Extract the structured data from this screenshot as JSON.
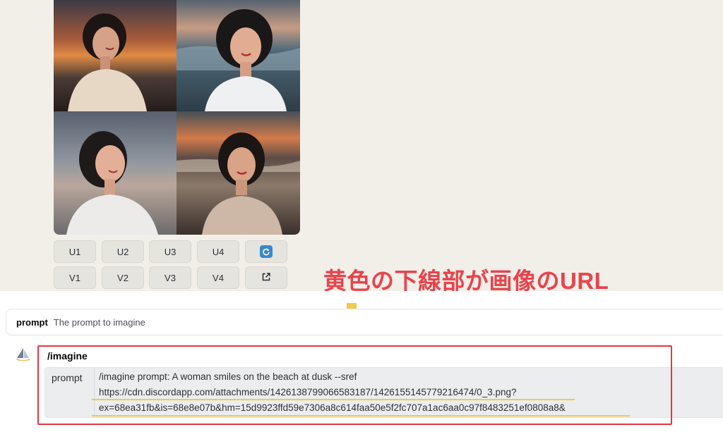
{
  "buttons": {
    "upscale": [
      "U1",
      "U2",
      "U3",
      "U4"
    ],
    "variation": [
      "V1",
      "V2",
      "V3",
      "V4"
    ],
    "reroll_icon": "refresh-icon",
    "share_icon": "external-link-icon"
  },
  "annotation": {
    "text": "黄色の下線部が画像のURL",
    "color": "#e8434b",
    "arrow_color": "#f2c94c"
  },
  "prompt_option": {
    "name": "prompt",
    "description": "The prompt to imagine"
  },
  "command": {
    "name": "/imagine",
    "param_label": "prompt",
    "value_lines": [
      "/imagine prompt: A woman smiles on the beach at dusk --sref",
      "https://cdn.discordapp.com/attachments/1426138799066583187/1426155145779216474/0_3.png?",
      "ex=68ea31fb&is=68e8e07b&hm=15d9923ffd59e7306a8c614faa50e5f2fc707a1ac6aa0c97f8483251ef0808a8&"
    ]
  },
  "colors": {
    "highlight_box": "#e53642",
    "underline": "#f2c94c",
    "reroll_badge": "#3a88c9"
  }
}
